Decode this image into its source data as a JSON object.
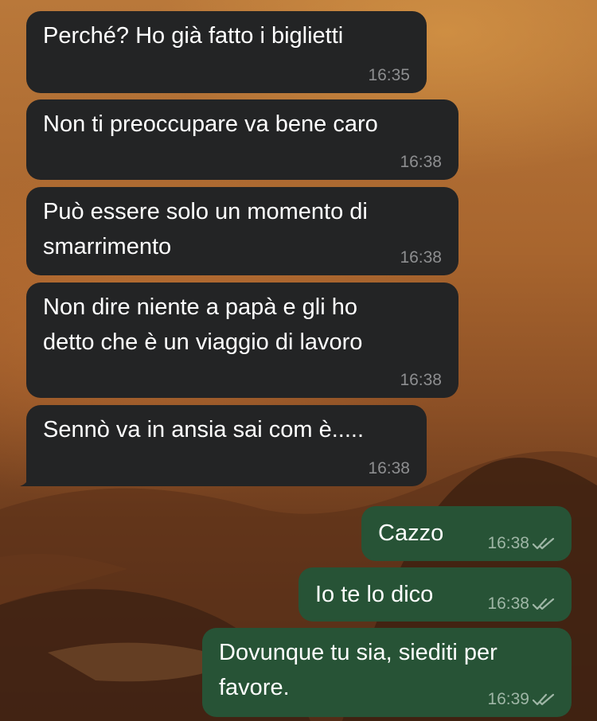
{
  "chat": {
    "messages": [
      {
        "direction": "incoming",
        "text": "Perché? Ho già fatto i biglietti",
        "time": "16:35"
      },
      {
        "direction": "incoming",
        "text": "Non ti preoccupare va bene caro",
        "time": "16:38"
      },
      {
        "direction": "incoming",
        "text": "Può essere solo un momento di\nsmarrimento",
        "time": "16:38"
      },
      {
        "direction": "incoming",
        "text": "Non dire niente a papà e gli ho\ndetto che è un viaggio di lavoro",
        "time": "16:38"
      },
      {
        "direction": "incoming",
        "text": "Sennò va in ansia sai com è.....",
        "time": "16:38"
      },
      {
        "direction": "outgoing",
        "text": "Cazzo",
        "time": "16:38",
        "status": "read"
      },
      {
        "direction": "outgoing",
        "text": "Io te lo dico",
        "time": "16:38",
        "status": "read"
      },
      {
        "direction": "outgoing",
        "text": "Dovunque tu sia, siediti per\nfavore.",
        "time": "16:39",
        "status": "read"
      }
    ]
  },
  "theme": {
    "incoming_bubble": "#232425",
    "outgoing_bubble": "#275336",
    "read_tick_icon": "double-check-icon"
  }
}
